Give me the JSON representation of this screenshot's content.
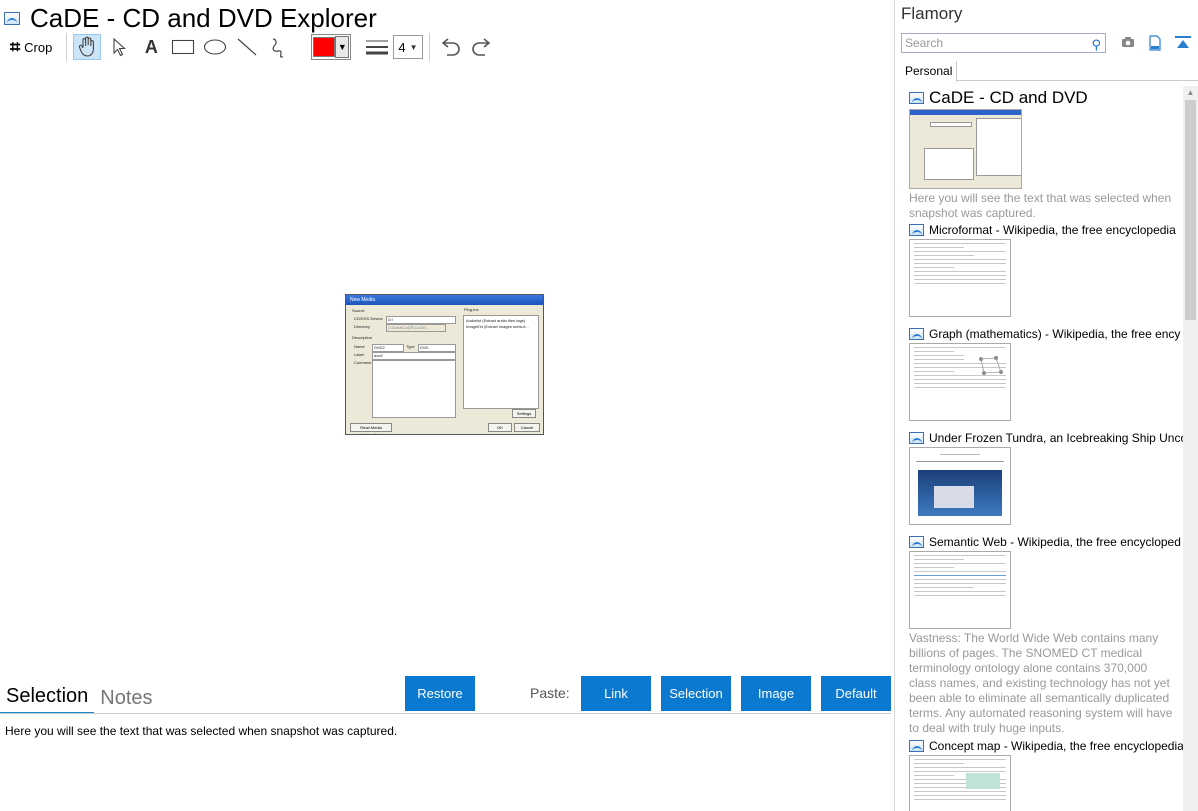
{
  "window": {
    "title": "CaDE - CD and DVD Explorer"
  },
  "toolbar": {
    "crop_label": "Crop",
    "line_width": "4",
    "color": "#ff0000",
    "tools": [
      "hand-icon",
      "pointer-icon",
      "text-icon",
      "rectangle-icon",
      "ellipse-icon",
      "line-icon",
      "freehand-icon"
    ]
  },
  "dialog_thumbnail": {
    "title": "New Media",
    "source_label": "Source",
    "device_label": "CD/DVD Device",
    "device_value": "D:\\",
    "directory_label": "Directory",
    "directory_value": "C:\\Data\\CaDE\\CaDE\\...",
    "plugins_label": "Plug-ins",
    "plugin1": "Audiolist (Extract audio files tags)",
    "plugin2": "ImageExt (Extract images meta-d...",
    "description_label": "Description",
    "name_label": "Name",
    "name_value": "DVD2",
    "type_label": "Type",
    "type_value": "DVD",
    "label_label": "Label",
    "label_value": "dvd2",
    "comment_label": "Comment",
    "settings_btn": "Settings",
    "read_btn": "Read Media Information",
    "ok_btn": "OK",
    "cancel_btn": "Cancel"
  },
  "bottom": {
    "tabs": {
      "selection": "Selection",
      "notes": "Notes"
    },
    "restore": "Restore",
    "paste_label": "Paste:",
    "paste_link": "Link",
    "paste_selection": "Selection",
    "paste_image": "Image",
    "paste_default": "Default",
    "selection_text": "Here you will see the text that was selected when snapshot was captured."
  },
  "sidebar": {
    "title": "Flamory",
    "search_placeholder": "Search",
    "tab": "Personal",
    "items": [
      {
        "title": "CaDE - CD and DVD",
        "desc": "Here you will see the text that was selected when snapshot was captured."
      },
      {
        "title": "Microformat - Wikipedia, the free encyclopedia"
      },
      {
        "title": "Graph (mathematics) - Wikipedia, the free ency"
      },
      {
        "title": "Under Frozen Tundra, an Icebreaking Ship Unco"
      },
      {
        "title": "Semantic Web - Wikipedia, the free encycloped",
        "desc": "Vastness: The World Wide Web contains many billions of pages. The SNOMED CT medical terminology ontology alone contains 370,000 class names, and existing technology has not yet been able to eliminate all semantically duplicated terms. Any automated reasoning system will have to deal with truly huge inputs."
      },
      {
        "title": "Concept map - Wikipedia, the free encyclopedia"
      }
    ]
  }
}
